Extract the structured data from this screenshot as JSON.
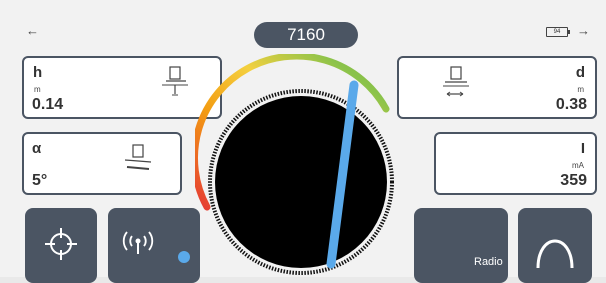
{
  "topbar": {
    "back_icon": "arrow-left-icon",
    "forward_icon": "arrow-right-icon",
    "battery_level": "94",
    "id": "7160"
  },
  "cards": {
    "h": {
      "label": "h",
      "unit": "m",
      "value": "0.14"
    },
    "d": {
      "label": "d",
      "unit": "m",
      "value": "0.38"
    },
    "alpha": {
      "label": "α",
      "value": "5°"
    },
    "current": {
      "label": "I",
      "unit": "mA",
      "value": "359"
    }
  },
  "buttons": {
    "locate_icon": "crosshair-icon",
    "signal_icon": "radio-signal-icon",
    "radio_label": "Radio",
    "mode_icon": "peak-arc-icon"
  },
  "colors": {
    "accent": "#4b5563",
    "beam": "#5aa9ea",
    "dial_bg": "#000000"
  }
}
